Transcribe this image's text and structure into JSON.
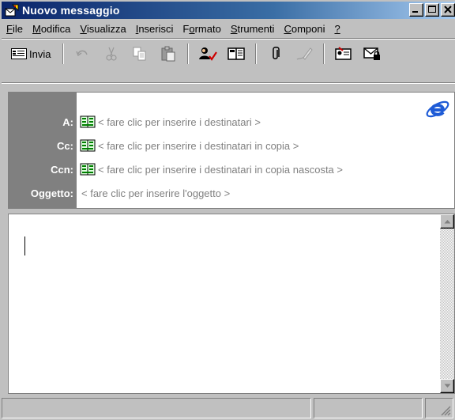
{
  "window": {
    "title": "Nuovo messaggio"
  },
  "menu": {
    "items": [
      {
        "pre": "",
        "u": "F",
        "post": "ile"
      },
      {
        "pre": "",
        "u": "M",
        "post": "odifica"
      },
      {
        "pre": "",
        "u": "V",
        "post": "isualizza"
      },
      {
        "pre": "",
        "u": "I",
        "post": "nserisci"
      },
      {
        "pre": "F",
        "u": "o",
        "post": "rmato"
      },
      {
        "pre": "",
        "u": "S",
        "post": "trumenti"
      },
      {
        "pre": "",
        "u": "C",
        "post": "omponi"
      },
      {
        "pre": "",
        "u": "?",
        "post": ""
      }
    ]
  },
  "toolbar": {
    "send_label": "Invia"
  },
  "header": {
    "to_label": "A:",
    "to_placeholder": "< fare clic per inserire i destinatari >",
    "cc_label": "Cc:",
    "cc_placeholder": "< fare clic per inserire i destinatari in copia >",
    "bcc_label": "Ccn:",
    "bcc_placeholder": "< fare clic per inserire i destinatari in copia nascosta >",
    "subject_label": "Oggetto:",
    "subject_placeholder": "< fare clic per inserire l'oggetto >"
  },
  "icons": {
    "title": "new-message-icon",
    "send": "send-icon",
    "undo": "undo-icon",
    "cut": "cut-icon",
    "copy": "copy-icon",
    "paste": "paste-icon",
    "check_names": "check-names-icon",
    "address_book": "address-book-icon",
    "attach": "attach-icon",
    "signature": "signature-icon",
    "business_card": "business-card-icon",
    "encrypt": "encrypt-icon",
    "ie_logo": "ie-logo-icon"
  },
  "colors": {
    "title_start": "#0a246a",
    "title_end": "#a6caf0",
    "label_bg": "#808080",
    "ie_blue": "#1e5bd6"
  }
}
